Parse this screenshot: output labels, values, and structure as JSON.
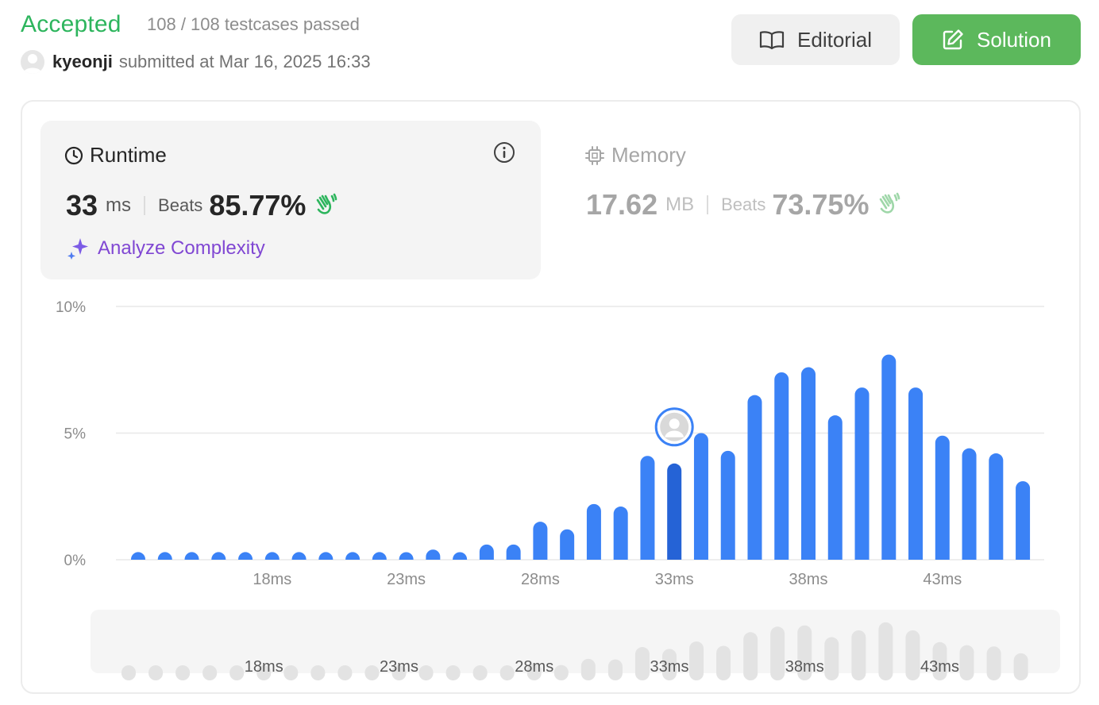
{
  "header": {
    "status": "Accepted",
    "testcases": "108 / 108 testcases passed",
    "username": "kyeonji",
    "submitted_text": "submitted at Mar 16, 2025 16:33",
    "editorial_label": "Editorial",
    "solution_label": "Solution"
  },
  "runtime": {
    "title": "Runtime",
    "value": "33",
    "unit": "ms",
    "beats_label": "Beats",
    "beats": "85.77%",
    "analyze_label": "Analyze Complexity"
  },
  "memory": {
    "title": "Memory",
    "value": "17.62",
    "unit": "MB",
    "beats_label": "Beats",
    "beats": "73.75%"
  },
  "colors": {
    "accepted": "#2db55d",
    "bar": "#3b82f6",
    "bar_selected": "#2563d6",
    "solution_button": "#5cb85c",
    "analyze": "#8047d3",
    "minibar": "#e3e3e3"
  },
  "chart_data": {
    "type": "bar",
    "x": [
      13,
      14,
      15,
      16,
      17,
      18,
      19,
      20,
      21,
      22,
      23,
      24,
      25,
      26,
      27,
      28,
      29,
      30,
      31,
      32,
      33,
      34,
      35,
      36,
      37,
      38,
      39,
      40,
      41,
      42,
      43,
      44,
      45,
      46
    ],
    "x_unit": "ms",
    "values": [
      0.3,
      0.3,
      0.3,
      0.3,
      0.3,
      0.3,
      0.3,
      0.3,
      0.3,
      0.3,
      0.3,
      0.4,
      0.3,
      0.6,
      0.6,
      1.5,
      1.2,
      2.2,
      2.1,
      4.1,
      3.8,
      5.0,
      4.3,
      6.5,
      7.4,
      7.6,
      5.7,
      6.8,
      8.1,
      6.8,
      4.9,
      4.4,
      4.2,
      3.1
    ],
    "selected_x": 33,
    "ylim": [
      0,
      10
    ],
    "yticks": [
      "0%",
      "5%",
      "10%"
    ],
    "ytick_values": [
      0,
      5,
      10
    ],
    "xticks": [
      "18ms",
      "23ms",
      "28ms",
      "33ms",
      "38ms",
      "43ms"
    ],
    "xtick_values": [
      18,
      23,
      28,
      33,
      38,
      43
    ],
    "grid": true
  }
}
